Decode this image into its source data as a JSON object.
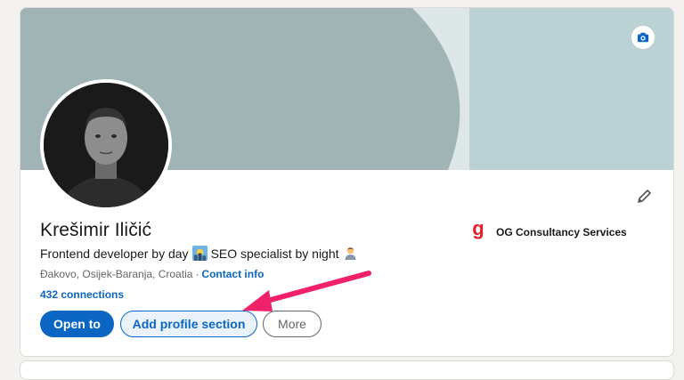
{
  "profile": {
    "name": "Krešimir Iličić",
    "headline_part1": "Frontend developer by day",
    "headline_part2": "SEO specialist by night",
    "location": "Đakovo, Osijek-Baranja, Croatia",
    "location_separator": "·",
    "contact_info_label": "Contact info",
    "connections": "432 connections"
  },
  "company": {
    "name": "OG Consultancy Services",
    "logo_letter": "g"
  },
  "actions": {
    "open_to": "Open to",
    "add_section": "Add profile section",
    "more": "More"
  },
  "icons": {
    "camera": "camera-icon",
    "edit": "pencil-icon",
    "emoji_day": "sun-over-city-emoji",
    "emoji_night": "technologist-emoji"
  },
  "colors": {
    "brand_blue": "#0a66c2",
    "cover_dark": "#a0b4b6",
    "cover_light": "#bcd1d4",
    "arrow": "#f0206a",
    "company_red": "#e0202e"
  }
}
